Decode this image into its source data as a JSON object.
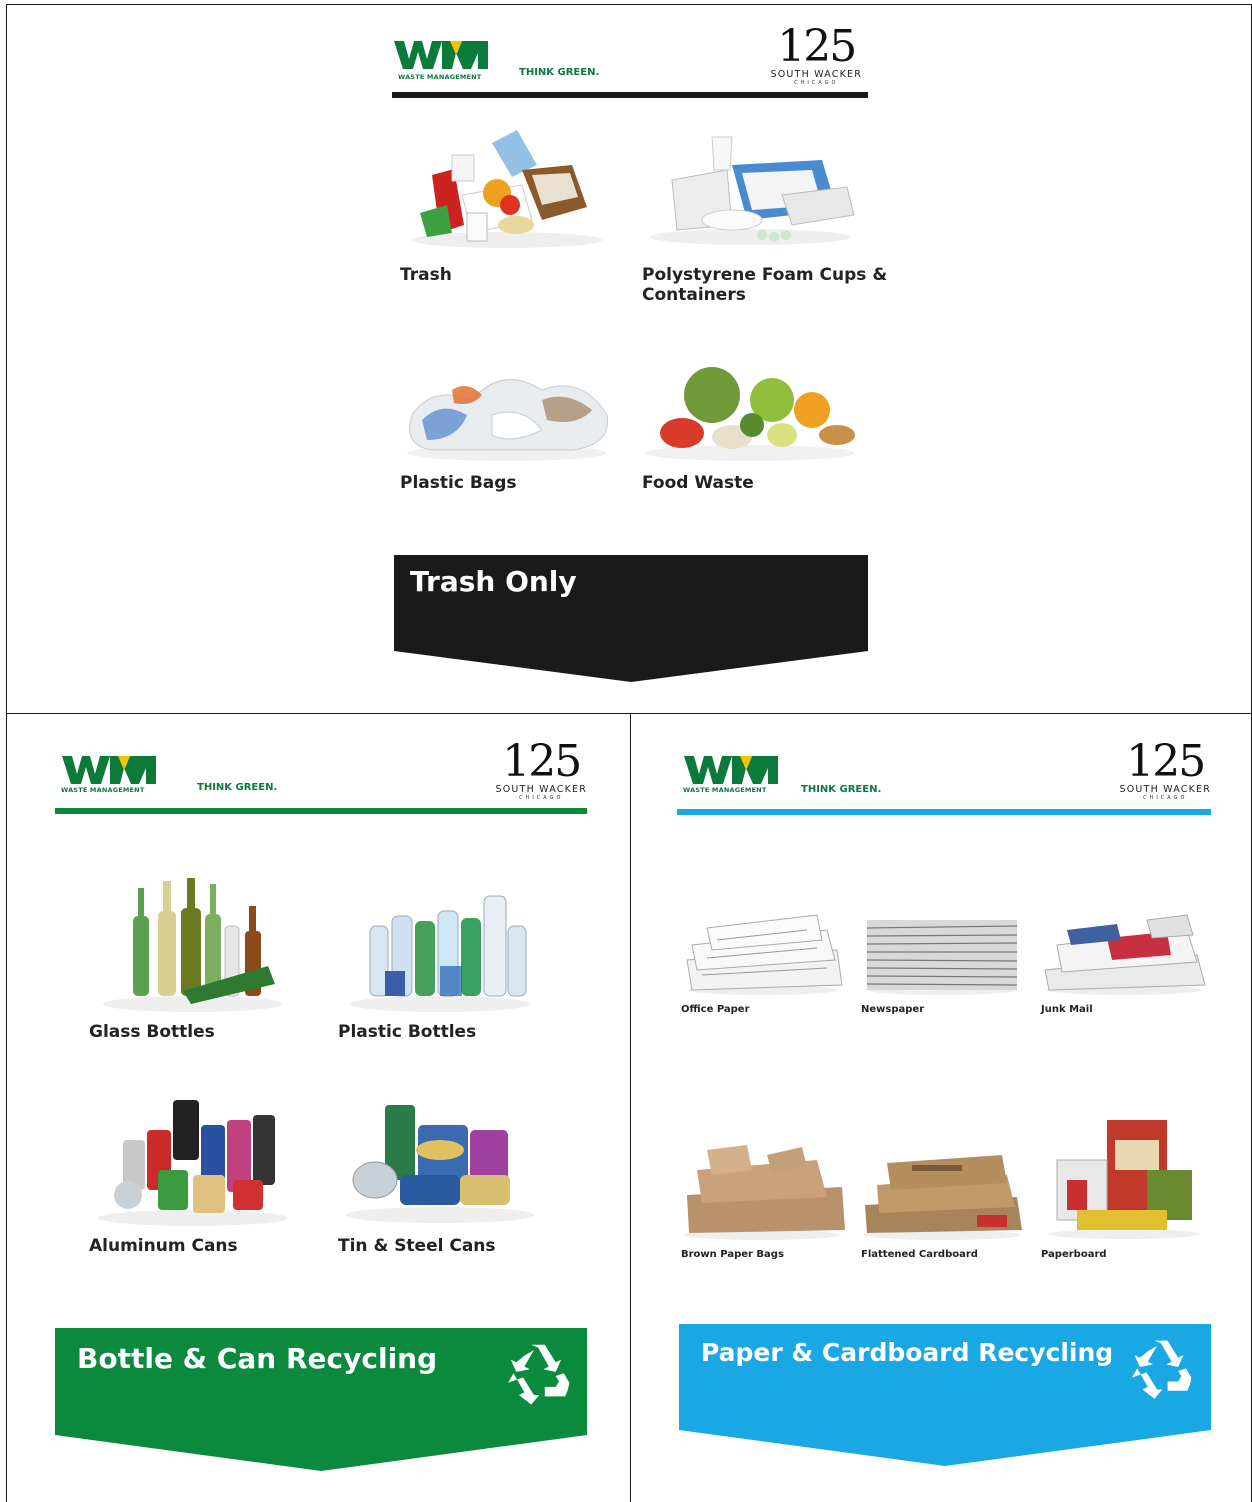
{
  "brand": {
    "wm_mark": "WM",
    "wm_subtitle": "WASTE MANAGEMENT",
    "slogan": "THINK GREEN.",
    "building_number": "125",
    "building_street": "SOUTH WACKER",
    "building_city": "CHICAGO"
  },
  "colors": {
    "trash": "#1a1a1a",
    "bottle_can": "#0b8a3e",
    "paper": "#1aa8e4",
    "wm_green": "#0b7a3b",
    "wm_yellow": "#f2c500"
  },
  "trash_panel": {
    "items": [
      {
        "label": "Trash",
        "icon": "mixed-trash-icon"
      },
      {
        "label": "Polystyrene Foam Cups &",
        "label2": "Containers",
        "icon": "foam-containers-icon"
      },
      {
        "label": "Plastic Bags",
        "icon": "plastic-bags-icon"
      },
      {
        "label": "Food Waste",
        "icon": "food-waste-icon"
      }
    ],
    "banner": "Trash Only"
  },
  "bottle_panel": {
    "items": [
      {
        "label": "Glass Bottles",
        "icon": "glass-bottles-icon"
      },
      {
        "label": "Plastic Bottles",
        "icon": "plastic-bottles-icon"
      },
      {
        "label": "Aluminum Cans",
        "icon": "aluminum-cans-icon"
      },
      {
        "label": "Tin & Steel Cans",
        "icon": "tin-cans-icon"
      }
    ],
    "banner": "Bottle & Can Recycling",
    "banner_icon": "recycle-icon"
  },
  "paper_panel": {
    "items": [
      {
        "label": "Office Paper",
        "icon": "office-paper-icon"
      },
      {
        "label": "Newspaper",
        "icon": "newspaper-icon"
      },
      {
        "label": "Junk Mail",
        "icon": "junk-mail-icon"
      },
      {
        "label": "Brown Paper Bags",
        "icon": "paper-bags-icon"
      },
      {
        "label": "Flattened Cardboard",
        "icon": "cardboard-icon"
      },
      {
        "label": "Paperboard",
        "icon": "paperboard-icon"
      }
    ],
    "banner": "Paper & Cardboard Recycling",
    "banner_icon": "recycle-icon"
  }
}
